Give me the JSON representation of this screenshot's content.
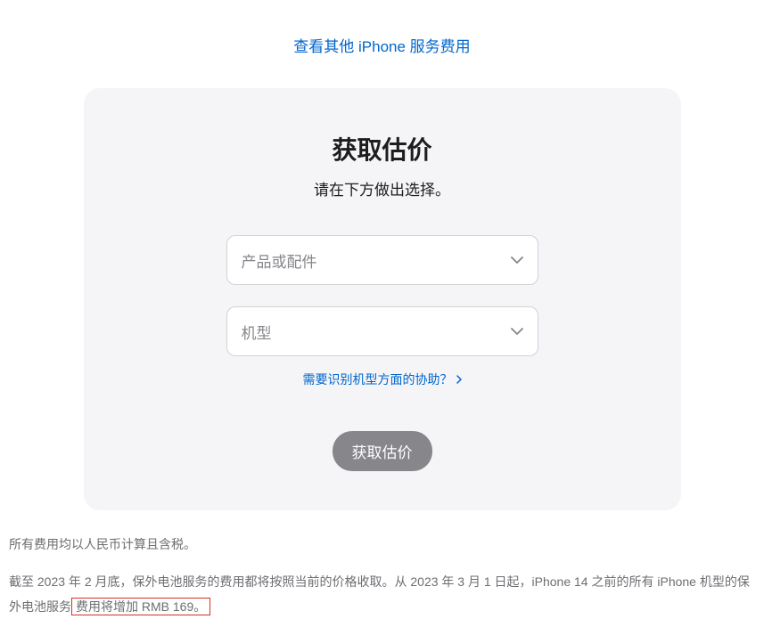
{
  "topLink": "查看其他 iPhone 服务费用",
  "card": {
    "title": "获取估价",
    "subtitle": "请在下方做出选择。",
    "select1": "产品或配件",
    "select2": "机型",
    "helpLink": "需要识别机型方面的协助？",
    "submitButton": "获取估价"
  },
  "footer": {
    "line1": "所有费用均以人民币计算且含税。",
    "line2a": "截至 2023 年 2 月底，保外电池服务的费用都将按照当前的价格收取。从 2023 年 3 月 1 日起，iPhone 14 之前的所有 iPhone 机型的保外电池服务",
    "line2b": "费用将增加 RMB 169。"
  }
}
